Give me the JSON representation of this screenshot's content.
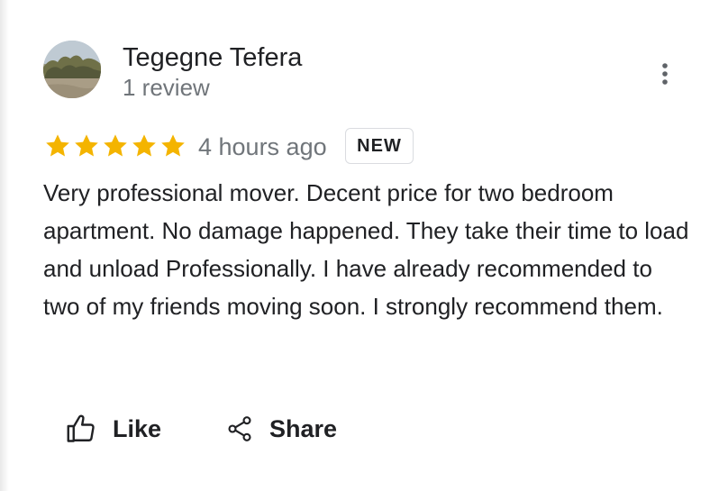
{
  "review": {
    "reviewer_name": "Tegegne Tefera",
    "review_count": "1 review",
    "rating": 5,
    "rating_max": 5,
    "time_ago": "4 hours ago",
    "badge": "NEW",
    "text": "Very professional mover. Decent price for two bedroom apartment. No damage happened. They take their time to load and unload Professionally. I have already recommended to two of my friends moving soon. I strongly recommend them."
  },
  "actions": {
    "like_label": "Like",
    "share_label": "Share"
  },
  "icons": {
    "more": "more-vert-icon",
    "star": "star-icon",
    "like": "thumb-up-icon",
    "share": "share-icon"
  },
  "colors": {
    "star": "#f4b400",
    "text": "#202124",
    "secondary_text": "#70757a",
    "badge_border": "#dadce0"
  }
}
